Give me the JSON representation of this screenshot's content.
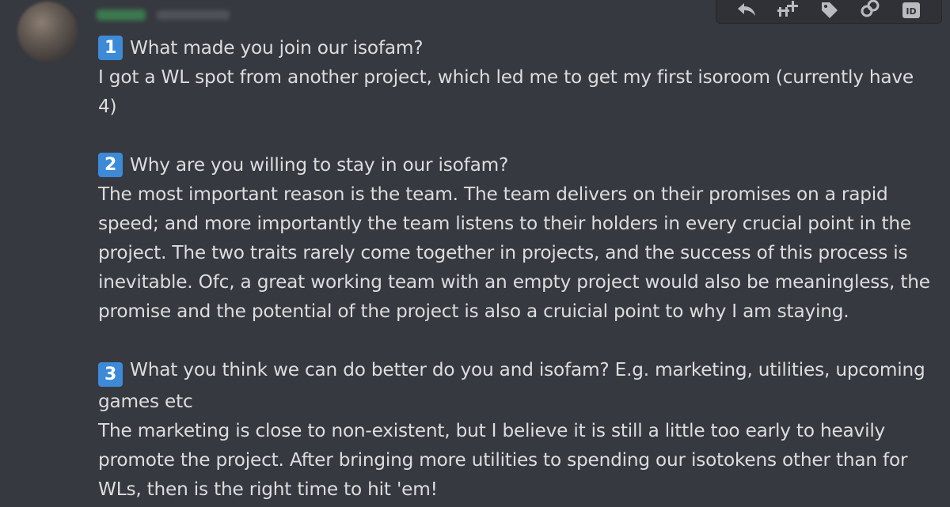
{
  "author": {
    "avatar_icon": "user-avatar-blurred",
    "name_redacted": true
  },
  "toolbar": {
    "icons": [
      "reply-icon",
      "create-thread-icon",
      "tag-icon",
      "link-icon",
      "id-icon"
    ],
    "id_label": "ID"
  },
  "message": {
    "sections": [
      {
        "number": "1",
        "question": "What made you join our isofam?",
        "answer": "I got a WL spot from another project, which led me to get my first isoroom (currently have 4)"
      },
      {
        "number": "2",
        "question": "Why are you willing to stay in our isofam?",
        "answer": "The most important reason is the team. The team delivers on their promises on a rapid speed; and more importantly the team listens to their holders in every crucial point in the project. The two traits rarely come together in projects, and the success of this process is inevitable. Ofc, a great working team with an empty project would also be meaningless, the promise and the potential of the project is also a cruicial point to why I am staying."
      },
      {
        "number": "3",
        "question": "What you think we can do better do you and isofam? E.g. marketing, utilities, upcoming games etc",
        "answer": "The marketing is close to non-existent, but I believe it is still a little too early to heavily promote the project. After bringing more utilities to spending our isotokens other than for WLs, then is the right time to hit 'em!"
      }
    ]
  },
  "colors": {
    "background": "#36393f",
    "text": "#dcddde",
    "number_badge": "#3c8ad8",
    "toolbar": "#2f3136"
  }
}
